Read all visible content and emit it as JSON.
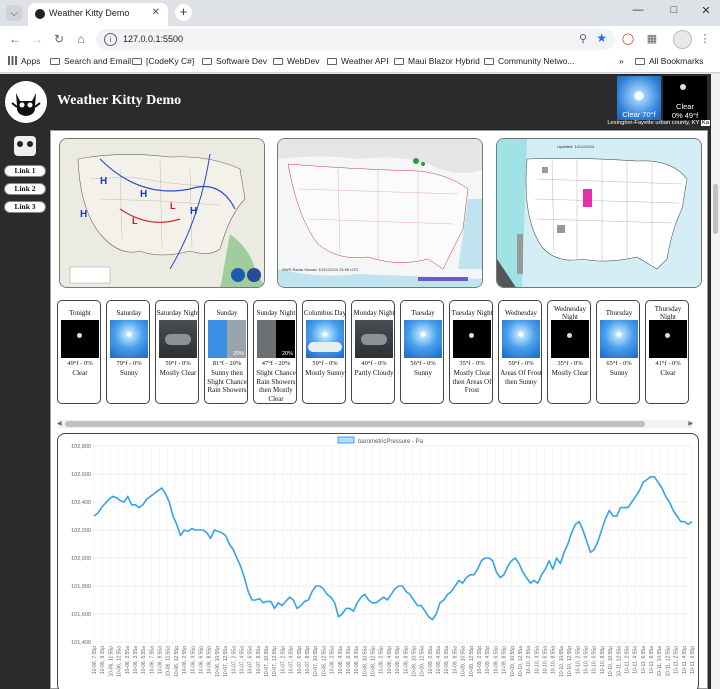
{
  "browser": {
    "tab_title": "Weather Kitty Demo",
    "url": "127.0.0.1:5500",
    "bookmarks": [
      "Apps",
      "Search and Email",
      "[CodeKy C#]",
      "Software Dev",
      "WebDev",
      "Weather API",
      "Maui Blazor Hybrid",
      "Community Netwo...",
      "All Bookmarks"
    ],
    "overflow_label": "»"
  },
  "site": {
    "title": "Weather Kitty Demo",
    "current": {
      "icon_label": "Clear 70°f",
      "condition": "Clear",
      "temp": "0% 49°f",
      "location": "Lexington-Fayette urban county, KY",
      "badge": "Ka"
    },
    "links": [
      "Link 1",
      "Link 2",
      "Link 3"
    ]
  },
  "maps": [
    {
      "name": "surface-analysis-map",
      "caption": "NWS Weather Prediction Center"
    },
    {
      "name": "radar-map",
      "caption": "NWS Radar Mosaic 10/11/2024 23:56 UTC"
    },
    {
      "name": "alerts-map",
      "caption": "Updated: 10/11/2024"
    }
  ],
  "forecast": [
    {
      "name": "Tonight",
      "temp": "49°f",
      "precip": "0%",
      "cond": "Clear",
      "img": "night"
    },
    {
      "name": "Saturday",
      "temp": "79°f",
      "precip": "0%",
      "cond": "Sunny",
      "img": "day"
    },
    {
      "name": "Saturday Night",
      "temp": "59°f",
      "precip": "0%",
      "cond": "Mostly Clear",
      "img": "pcloud"
    },
    {
      "name": "Sunday",
      "temp": "81°f",
      "precip": "20%",
      "cond": "Sunny then Slight Chance Rain Showers",
      "img": "split-rain",
      "pct": "20%"
    },
    {
      "name": "Sunday Night",
      "temp": "47°f",
      "precip": "20%",
      "cond": "Slight Chance Rain Showers then Mostly Clear",
      "img": "split-night",
      "pct": "20%"
    },
    {
      "name": "Columbus Day",
      "temp": "59°f",
      "precip": "0%",
      "cond": "Mostly Sunny",
      "img": "psunny"
    },
    {
      "name": "Monday Night",
      "temp": "40°f",
      "precip": "0%",
      "cond": "Partly Cloudy",
      "img": "pcloud"
    },
    {
      "name": "Tuesday",
      "temp": "56°f",
      "precip": "0%",
      "cond": "Sunny",
      "img": "day"
    },
    {
      "name": "Tuesday Night",
      "temp": "35°f",
      "precip": "0%",
      "cond": "Mostly Clear then Areas Of Frost",
      "img": "night"
    },
    {
      "name": "Wednesday",
      "temp": "59°f",
      "precip": "0%",
      "cond": "Areas Of Frost then Sunny",
      "img": "day"
    },
    {
      "name": "Wednesday Night",
      "temp": "35°f",
      "precip": "0%",
      "cond": "Mostly Clear",
      "img": "night"
    },
    {
      "name": "Thursday",
      "temp": "65°f",
      "precip": "0%",
      "cond": "Sunny",
      "img": "day"
    },
    {
      "name": "Thursday Night",
      "temp": "41°f",
      "precip": "0%",
      "cond": "Clear",
      "img": "night"
    }
  ],
  "chart_data": {
    "type": "line",
    "series": [
      {
        "name": "barometricPressure - Pa",
        "color": "#36a2eb"
      }
    ],
    "ylim": [
      101400,
      102800
    ],
    "yticks": [
      101400,
      101600,
      101800,
      102000,
      102200,
      102400,
      102600,
      102800
    ],
    "xtick_labels": [
      "10-06, 7:55p",
      "10-06, 9:15p",
      "10-06, 11:55p",
      "10-06, 12:55a",
      "10-06, 2:55a",
      "10-06, 3:55a",
      "10-06, 5:55a",
      "10-06, 7:55a",
      "10-06, 9:55a",
      "10-06, 11:55a",
      "10-06, 12:55p",
      "10-06, 2:55p",
      "10-06, 4:55p",
      "10-06, 6:55p",
      "10-06, 8:55p",
      "10-06, 10:55p",
      "10-07, 12:55a",
      "10-07, 2:55a",
      "10-07, 4:55a",
      "10-07, 6:55a",
      "10-07, 8:55a",
      "10-07, 10:55a",
      "10-07, 12:55p",
      "10-07, 2:55p",
      "10-07, 4:55p",
      "10-07, 6:55p",
      "10-07, 8:55p",
      "10-07, 10:55p",
      "10-08, 12:55a",
      "10-08, 2:55a",
      "10-08, 4:55a",
      "10-08, 6:55a",
      "10-08, 8:55a",
      "10-08, 10:55a",
      "10-08, 12:55p",
      "10-08, 2:55p",
      "10-08, 4:55p",
      "10-08, 6:55p",
      "10-08, 8:55p",
      "10-08, 10:55p",
      "10-09, 12:55a",
      "10-09, 2:55a",
      "10-09, 4:55a",
      "10-09, 6:55a",
      "10-09, 8:55a",
      "10-09, 10:55a",
      "10-09, 12:55p",
      "10-09, 2:55p",
      "10-09, 4:55p",
      "10-09, 6:55p",
      "10-09, 8:55p",
      "10-09, 10:55p",
      "10-10, 12:55a",
      "10-10, 2:55a",
      "10-10, 4:55a",
      "10-10, 6:55a",
      "10-10, 8:55a",
      "10-10, 10:55a",
      "10-10, 12:55p",
      "10-10, 2:55p",
      "10-10, 4:55p",
      "10-10, 6:55p",
      "10-10, 8:55p",
      "10-10, 10:55p",
      "10-11, 12:55a",
      "10-11, 2:55a",
      "10-11, 4:55a",
      "10-11, 6:55a",
      "10-11, 8:55a",
      "10-11, 10:55a",
      "10-11, 12:55p",
      "10-11, 2:55p",
      "10-11, 4:55p",
      "10-11, 6:55p"
    ],
    "values": [
      102300,
      102320,
      102360,
      102390,
      102420,
      102440,
      102430,
      102410,
      102400,
      102440,
      102380,
      102380,
      102360,
      102380,
      102420,
      102440,
      102460,
      102480,
      102500,
      102460,
      102400,
      102300,
      102240,
      102160,
      102200,
      102190,
      102210,
      102200,
      102200,
      102200,
      102180,
      102140,
      102200,
      102190,
      102180,
      102160,
      102100,
      102060,
      102000,
      101940,
      101860,
      101760,
      101700,
      101700,
      101710,
      101680,
      101690,
      101690,
      101640,
      101680,
      101660,
      101690,
      101720,
      101700,
      101640,
      101660,
      101690,
      101700,
      101760,
      101800,
      101800,
      101780,
      101740,
      101720,
      101680,
      101580,
      101600,
      101640,
      101640,
      101620,
      101680,
      101720,
      101740,
      101700,
      101680,
      101680,
      101700,
      101720,
      101700,
      101740,
      101780,
      101800,
      101800,
      101760,
      101740,
      101700,
      101660,
      101660,
      101620,
      101580,
      101560,
      101600,
      101680,
      101700,
      101740,
      101760,
      101800,
      101840,
      101820,
      101860,
      101880,
      101880,
      101920,
      101980,
      102000,
      102000,
      101980,
      101900,
      101860,
      101880,
      101940,
      101980,
      102000,
      101960,
      101900,
      101860,
      101820,
      101840,
      101820,
      101880,
      101920,
      101980,
      101920,
      102000,
      101960,
      102040,
      102100,
      102180,
      102240,
      102260,
      102200,
      102120,
      102040,
      102060,
      102120,
      102200,
      102280,
      102340,
      102300,
      102300,
      102360,
      102360,
      102360,
      102400,
      102440,
      102480,
      102540,
      102560,
      102580,
      102580,
      102540,
      102500,
      102440,
      102400,
      102340,
      102300,
      102260,
      102260,
      102240,
      102260
    ],
    "title": "",
    "xlabel": "",
    "ylabel": ""
  }
}
